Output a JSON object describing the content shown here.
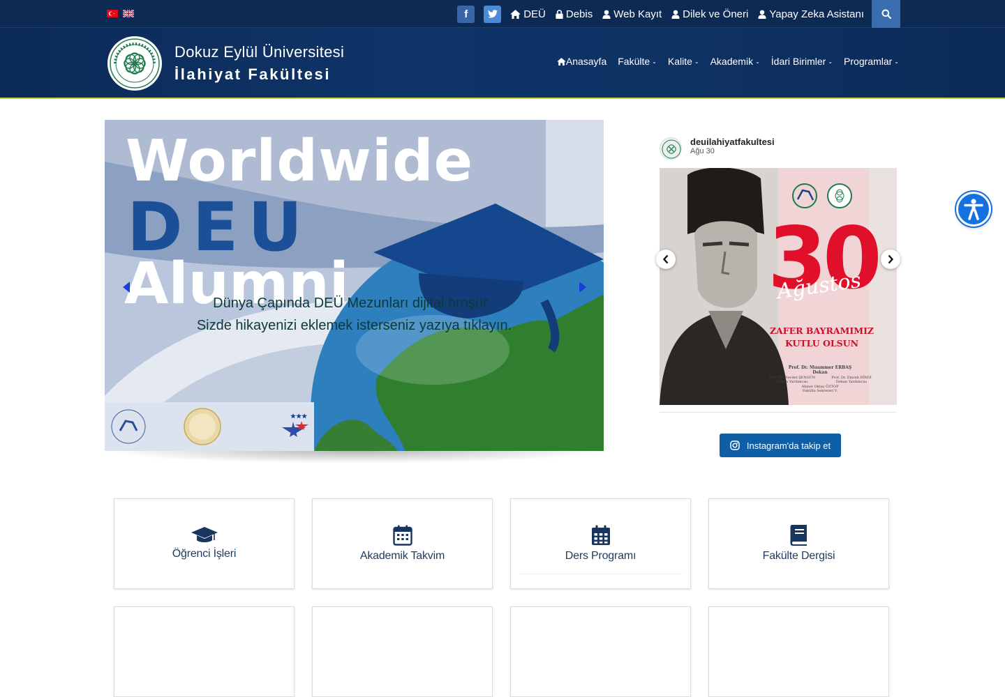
{
  "topbar": {
    "flags": [
      {
        "name": "turkish-flag-icon",
        "lang": "TR"
      },
      {
        "name": "english-flag-icon",
        "lang": "EN"
      }
    ],
    "social": [
      {
        "name": "facebook-icon",
        "glyph": "f"
      },
      {
        "name": "twitter-icon",
        "glyph": "t"
      }
    ],
    "links": [
      {
        "label": "DEÜ",
        "icon": "home-icon"
      },
      {
        "label": "Debis",
        "icon": "lock-icon"
      },
      {
        "label": "Web Kayıt",
        "icon": "user-icon"
      },
      {
        "label": "Dilek ve Öneri",
        "icon": "user-icon"
      },
      {
        "label": "Yapay Zeka Asistanı",
        "icon": "user-icon"
      }
    ],
    "search_icon": "search-icon"
  },
  "header": {
    "brand_line1": "Dokuz Eylül Üniversitesi",
    "brand_line2": "İlahiyat Fakültesi",
    "nav": [
      {
        "label": "Anasayfa",
        "icon": "home-icon",
        "dropdown": false
      },
      {
        "label": "Fakülte",
        "dropdown": true
      },
      {
        "label": "Kalite",
        "dropdown": true
      },
      {
        "label": "Akademik",
        "dropdown": true
      },
      {
        "label": "İdari Birimler",
        "dropdown": true
      },
      {
        "label": "Programlar",
        "dropdown": true
      }
    ],
    "accent_line_color": "#c3d54a",
    "bg_color": "#0f3468"
  },
  "slider": {
    "title_line1": "Worldwide",
    "title_line2": "DEU",
    "title_line3": "Alumni",
    "caption_line1": "Dünya Çapında DEÜ Mezunları dijital broşür .",
    "caption_line2": "Sizde hikayenizi eklemek isterseniz yazıya tıklayın."
  },
  "instagram": {
    "username": "deuilahiyatfakultesi",
    "date": "Ağu 30",
    "post": {
      "number": "30",
      "script": "Ağustos",
      "message_line1": "ZAFER BAYRAMIMIZ",
      "message_line2": "KUTLU OLSUN",
      "sign_main_name": "Prof. Dr. Muammer ERBAŞ",
      "sign_main_title": "Dekan",
      "sign_left_name": "Prof. Dr. Necdet ŞENGÜN",
      "sign_left_title": "Dekan Yardımcısı",
      "sign_right_name": "Prof. Dr. Emrah DİNDİ",
      "sign_right_title": "Dekan Yardımcısı",
      "sign_bottom_name": "Ahmet Oktay ÖZTOP",
      "sign_bottom_title": "Fakülte Sekreteri V."
    },
    "follow_label": "Instagram'da takip et"
  },
  "cards": [
    {
      "label": "Öğrenci İşleri",
      "icon": "graduation-cap-icon"
    },
    {
      "label": "Akademik Takvim",
      "icon": "calendar-icon"
    },
    {
      "label": "Ders Programı",
      "icon": "calendar-grid-icon"
    },
    {
      "label": "Fakülte Dergisi",
      "icon": "book-icon"
    }
  ],
  "colors": {
    "topbar_bg": "#0d2a55",
    "button_blue": "#0f5fa6",
    "accessibility_blue": "#1570e0",
    "card_text": "#1d3a5e"
  }
}
